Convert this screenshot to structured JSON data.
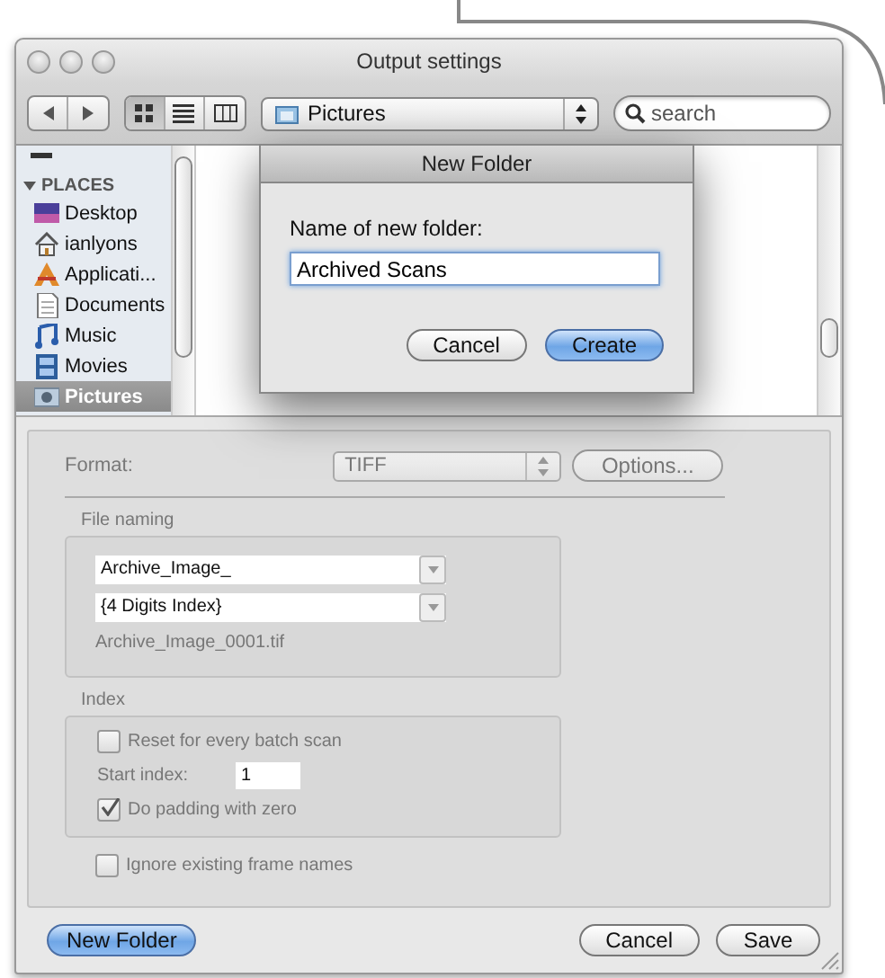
{
  "window": {
    "title": "Output settings"
  },
  "toolbar": {
    "nav": [
      {
        "kind": "back"
      },
      {
        "kind": "forward"
      }
    ],
    "views": [
      {
        "kind": "icons",
        "selected": true
      },
      {
        "kind": "list",
        "selected": false
      },
      {
        "kind": "columns",
        "selected": false
      }
    ],
    "location": "Pictures",
    "search": {
      "placeholder": "search"
    }
  },
  "sidebar": {
    "section": "PLACES",
    "expanded": true,
    "items": [
      {
        "label": "Desktop",
        "kind": "desktop",
        "selected": false
      },
      {
        "label": "ianlyons",
        "kind": "home",
        "selected": false
      },
      {
        "label": "Applicati...",
        "kind": "apps",
        "selected": false
      },
      {
        "label": "Documents",
        "kind": "docs",
        "selected": false
      },
      {
        "label": "Music",
        "kind": "music",
        "selected": false
      },
      {
        "label": "Movies",
        "kind": "movies",
        "selected": false
      },
      {
        "label": "Pictures",
        "kind": "pictures",
        "selected": true
      }
    ]
  },
  "dialog": {
    "title": "New Folder",
    "prompt": "Name of new folder:",
    "value": "Archived Scans",
    "buttons": [
      {
        "label": "Cancel",
        "default": false
      },
      {
        "label": "Create",
        "default": true
      }
    ]
  },
  "settings": {
    "disabled": true,
    "format": {
      "label": "Format:",
      "value": "TIFF",
      "button": "Options..."
    },
    "file_naming": {
      "title": "File naming",
      "prefix": "Archive_Image_",
      "index_format": "{4 Digits Index}",
      "preview": "Archive_Image_0001.tif"
    },
    "index": {
      "title": "Index",
      "reset": {
        "label": "Reset for every batch scan",
        "checked": false
      },
      "start": {
        "label": "Start index:",
        "value": "1"
      },
      "padding": {
        "label": "Do padding with zero",
        "checked": true
      }
    },
    "ignore": {
      "label": "Ignore existing frame names",
      "checked": false
    }
  },
  "footer": {
    "new_folder": "New Folder",
    "buttons": [
      {
        "label": "Cancel",
        "default": false
      },
      {
        "label": "Save",
        "default": false
      }
    ]
  }
}
